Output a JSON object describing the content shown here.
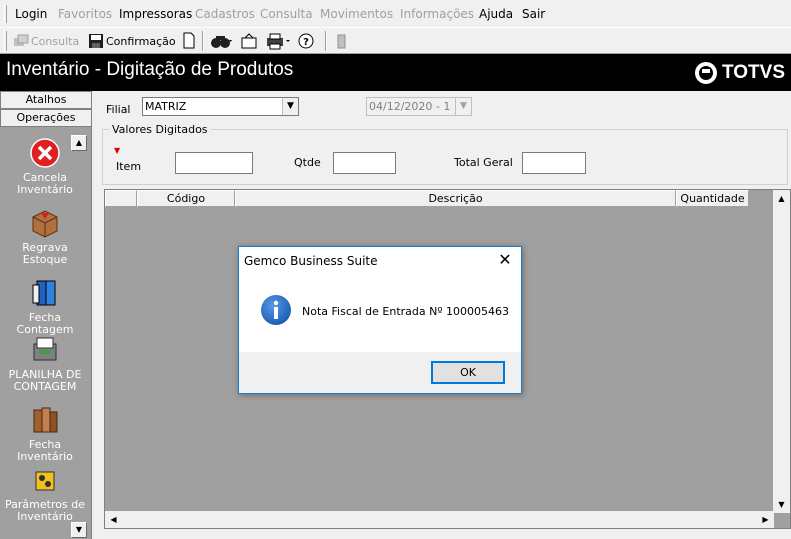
{
  "menubar": {
    "items": [
      {
        "label": "Login",
        "enabled": true
      },
      {
        "label": "Favoritos",
        "enabled": false
      },
      {
        "label": "Impressoras",
        "enabled": true
      },
      {
        "label": "Cadastros",
        "enabled": false
      },
      {
        "label": "Consulta",
        "enabled": false
      },
      {
        "label": "Movimentos",
        "enabled": false
      },
      {
        "label": "Informações",
        "enabled": false
      },
      {
        "label": "Ajuda",
        "enabled": true
      },
      {
        "label": "Sair",
        "enabled": true
      }
    ]
  },
  "toolbar": {
    "consulta_label": "Consulta",
    "confirmacao_label": "Confirmação"
  },
  "window": {
    "title": "Inventário - Digitação de Produtos",
    "logo_text": "TOTVS"
  },
  "leftpanel": {
    "tabs": [
      "Atalhos",
      "Operações"
    ],
    "items": [
      {
        "label": "Cancela Inventário",
        "icon": "cancel-icon"
      },
      {
        "label": "Regrava Estoque",
        "icon": "box-icon"
      },
      {
        "label": "Fecha Contagem",
        "icon": "binder-icon"
      },
      {
        "label": "PLANILHA DE CONTAGEM",
        "icon": "spreadsheet-icon"
      },
      {
        "label": "Fecha Inventário",
        "icon": "books-icon"
      },
      {
        "label": "Parâmetros de Inventário",
        "icon": "parameters-icon"
      }
    ]
  },
  "form": {
    "filial_label": "Filial",
    "filial_value": "MATRIZ",
    "date_value": "04/12/2020 - 1",
    "group_title": "Valores Digitados",
    "item_label": "Item",
    "item_value": "",
    "qtde_label": "Qtde",
    "qtde_value": "",
    "total_label": "Total Geral",
    "total_value": ""
  },
  "grid": {
    "columns": [
      "",
      "Código",
      "Descrição",
      "Quantidade"
    ]
  },
  "dialog": {
    "title": "Gemco Business Suite",
    "message": "Nota Fiscal de Entrada Nº 100005463",
    "ok_label": "OK",
    "icon": "info-icon"
  },
  "colors": {
    "titlebar_bg": "#000000",
    "panel_bg": "#a0a0a0",
    "window_bg": "#f0f0f0",
    "dialog_border": "#1979ca",
    "info_icon_blue": "#1d5fb4",
    "cancel_red": "#e02020"
  }
}
